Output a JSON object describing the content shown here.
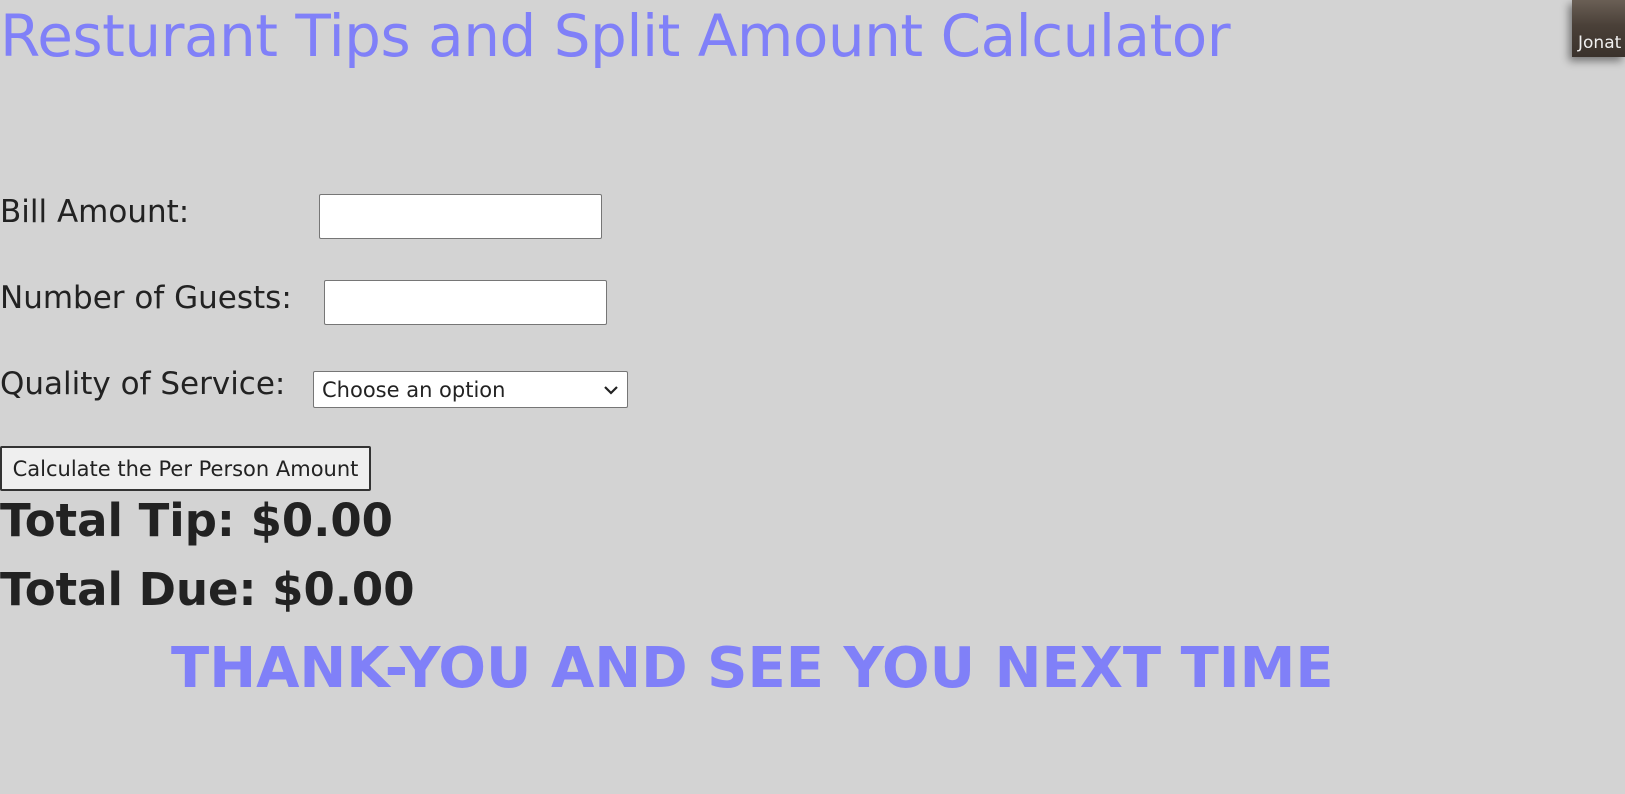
{
  "title": "Resturant Tips and Split Amount Calculator",
  "form": {
    "bill_label": "Bill Amount:",
    "bill_value": "",
    "guests_label": "Number of Guests:",
    "guests_value": "",
    "service_label": "Quality of Service:",
    "service_selected": "Choose an option",
    "calculate_label": "Calculate the Per Person Amount"
  },
  "results": {
    "total_tip": "Total Tip: $0.00",
    "total_due": "Total Due: $0.00"
  },
  "footer": {
    "thanks": "THANK-YOU AND SEE YOU NEXT TIME"
  },
  "participant": {
    "name": "Jonat"
  },
  "colors": {
    "background": "#d3d3d3",
    "accent": "#8080f8",
    "text": "#222222"
  },
  "icons": {
    "select_chevron": "chevron-down-icon"
  }
}
